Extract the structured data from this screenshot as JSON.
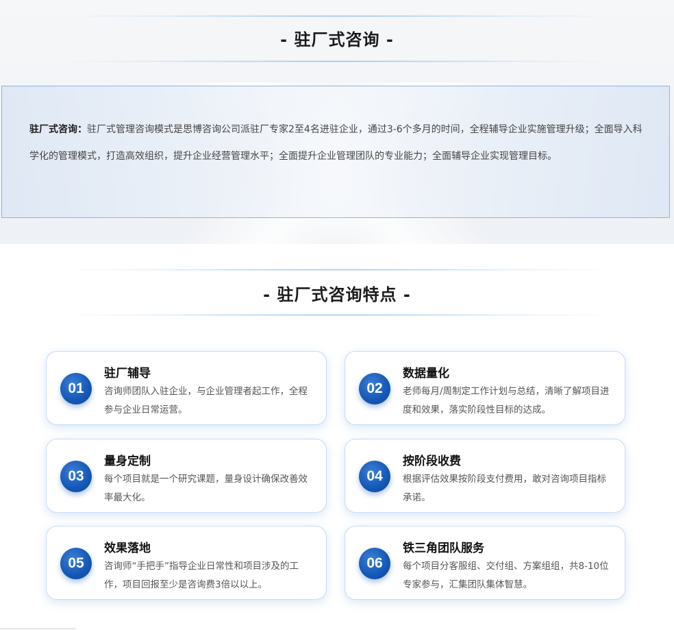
{
  "section1": {
    "title": "- 驻厂式咨询 -",
    "intro_label": "驻厂式咨询：",
    "intro_text": "驻厂式管理咨询模式是思博咨询公司派驻厂专家2至4名进驻企业，通过3-6个多月的时间，全程辅导企业实施管理升级；全面导入科学化的管理模式，打造高效组织，提升企业经营管理水平；全面提升企业管理团队的专业能力；全面辅导企业实现管理目标。"
  },
  "section2": {
    "title": "- 驻厂式咨询特点 -",
    "cards": [
      {
        "num": "01",
        "title": "驻厂辅导",
        "desc": "咨询师团队入驻企业，与企业管理者起工作，全程参与企业日常运营。"
      },
      {
        "num": "02",
        "title": "数据量化",
        "desc": "老师每月/周制定工作计划与总结，清晰了解项目进度和效果，落实阶段性目标的达成。"
      },
      {
        "num": "03",
        "title": "量身定制",
        "desc": "每个项目就是一个研究课题，量身设计确保改善效率最大化。"
      },
      {
        "num": "04",
        "title": "按阶段收费",
        "desc": "根据评估效果按阶段支付费用，敢对咨询项目指标承诺。"
      },
      {
        "num": "05",
        "title": "效果落地",
        "desc": "咨询师“手把手”指导企业日常性和项目涉及的工作，项目回报至少是咨询费3倍以以上。"
      },
      {
        "num": "06",
        "title": "铁三角团队服务",
        "desc": "每个项目分客服组、交付组、方案组组，共8-10位专家参与，汇集团队集体智慧。"
      }
    ]
  },
  "colors": {
    "accent_blue": "#1457b5",
    "border_blue": "#8ab4e8",
    "card_border": "#c5dcf4"
  }
}
